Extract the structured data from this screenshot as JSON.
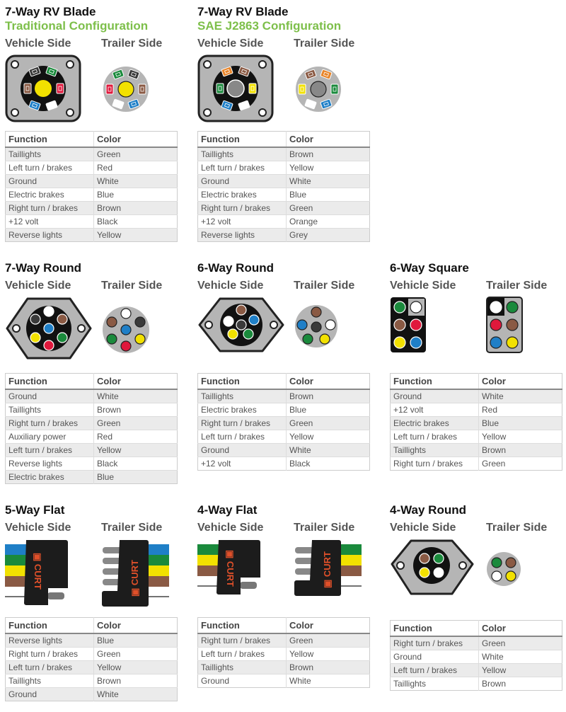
{
  "side_labels": {
    "vehicle": "Vehicle Side",
    "trailer": "Trailer Side"
  },
  "table_headers": {
    "function": "Function",
    "color": "Color"
  },
  "colors": {
    "Green": "#1a8a3c",
    "Red": "#e0183c",
    "White": "#ffffff",
    "Blue": "#1f7fc7",
    "Brown": "#8a5a44",
    "Black": "#3a3a3a",
    "Yellow": "#f2e100",
    "Orange": "#e8852a",
    "Grey": "#888888",
    "subtitle_green": "#7dbf4a",
    "connector_grey": "#b5b5b5"
  },
  "panels": [
    {
      "id": "rv-traditional",
      "title": "7-Way RV Blade",
      "subtitle": "Traditional Configuration",
      "rows": [
        {
          "function": "Taillights",
          "color": "Green"
        },
        {
          "function": "Left turn / brakes",
          "color": "Red"
        },
        {
          "function": "Ground",
          "color": "White"
        },
        {
          "function": "Electric brakes",
          "color": "Blue"
        },
        {
          "function": "Right turn / brakes",
          "color": "Brown"
        },
        {
          "function": "+12 volt",
          "color": "Black"
        },
        {
          "function": "Reverse lights",
          "color": "Yellow"
        }
      ]
    },
    {
      "id": "rv-sae",
      "title": "7-Way RV Blade",
      "subtitle": "SAE J2863 Configuration",
      "rows": [
        {
          "function": "Taillights",
          "color": "Brown"
        },
        {
          "function": "Left turn / brakes",
          "color": "Yellow"
        },
        {
          "function": "Ground",
          "color": "White"
        },
        {
          "function": "Electric brakes",
          "color": "Blue"
        },
        {
          "function": "Right turn / brakes",
          "color": "Green"
        },
        {
          "function": "+12 volt",
          "color": "Orange"
        },
        {
          "function": "Reverse lights",
          "color": "Grey"
        }
      ]
    },
    {
      "id": "7-round",
      "title": "7-Way Round",
      "rows": [
        {
          "function": "Ground",
          "color": "White"
        },
        {
          "function": "Taillights",
          "color": "Brown"
        },
        {
          "function": "Right turn / brakes",
          "color": "Green"
        },
        {
          "function": "Auxiliary power",
          "color": "Red"
        },
        {
          "function": "Left turn / brakes",
          "color": "Yellow"
        },
        {
          "function": "Reverse lights",
          "color": "Black"
        },
        {
          "function": "Electric brakes",
          "color": "Blue"
        }
      ]
    },
    {
      "id": "6-round",
      "title": "6-Way Round",
      "rows": [
        {
          "function": "Taillights",
          "color": "Brown"
        },
        {
          "function": "Electric brakes",
          "color": "Blue"
        },
        {
          "function": "Right turn / brakes",
          "color": "Green"
        },
        {
          "function": "Left turn / brakes",
          "color": "Yellow"
        },
        {
          "function": "Ground",
          "color": "White"
        },
        {
          "function": "+12 volt",
          "color": "Black"
        }
      ]
    },
    {
      "id": "6-square",
      "title": "6-Way Square",
      "rows": [
        {
          "function": "Ground",
          "color": "White"
        },
        {
          "function": "+12 volt",
          "color": "Red"
        },
        {
          "function": "Electric brakes",
          "color": "Blue"
        },
        {
          "function": "Left turn / brakes",
          "color": "Yellow"
        },
        {
          "function": "Taillights",
          "color": "Brown"
        },
        {
          "function": "Right turn / brakes",
          "color": "Green"
        }
      ]
    },
    {
      "id": "5-flat",
      "title": "5-Way Flat",
      "brand": "CURT",
      "rows": [
        {
          "function": "Reverse lights",
          "color": "Blue"
        },
        {
          "function": "Right turn / brakes",
          "color": "Green"
        },
        {
          "function": "Left turn / brakes",
          "color": "Yellow"
        },
        {
          "function": "Taillights",
          "color": "Brown"
        },
        {
          "function": "Ground",
          "color": "White"
        }
      ]
    },
    {
      "id": "4-flat",
      "title": "4-Way Flat",
      "brand": "CURT",
      "rows": [
        {
          "function": "Right turn / brakes",
          "color": "Green"
        },
        {
          "function": "Left turn / brakes",
          "color": "Yellow"
        },
        {
          "function": "Taillights",
          "color": "Brown"
        },
        {
          "function": "Ground",
          "color": "White"
        }
      ]
    },
    {
      "id": "4-round",
      "title": "4-Way Round",
      "rows": [
        {
          "function": "Right turn / brakes",
          "color": "Green"
        },
        {
          "function": "Ground",
          "color": "White"
        },
        {
          "function": "Left turn / brakes",
          "color": "Yellow"
        },
        {
          "function": "Taillights",
          "color": "Brown"
        }
      ]
    }
  ]
}
